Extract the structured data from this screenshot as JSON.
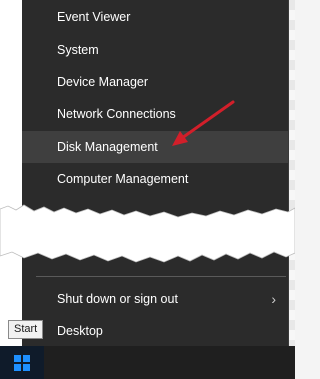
{
  "menu": {
    "items": [
      {
        "label": "Event Viewer"
      },
      {
        "label": "System"
      },
      {
        "label": "Device Manager"
      },
      {
        "label": "Network Connections"
      },
      {
        "label": "Disk Management"
      },
      {
        "label": "Computer Management"
      }
    ],
    "lower_items": [
      {
        "label": "Shut down or sign out"
      },
      {
        "label": "Desktop"
      }
    ]
  },
  "tooltip": {
    "text": "Start"
  },
  "icons": {
    "submenu": "chevron-right-icon",
    "start": "windows-logo-icon",
    "annotation": "red-arrow-icon"
  },
  "colors": {
    "menu_bg": "#2b2b2b",
    "hover_bg": "#3f3f3f",
    "arrow": "#d21f2a",
    "start_logo": "#1e90ff"
  }
}
